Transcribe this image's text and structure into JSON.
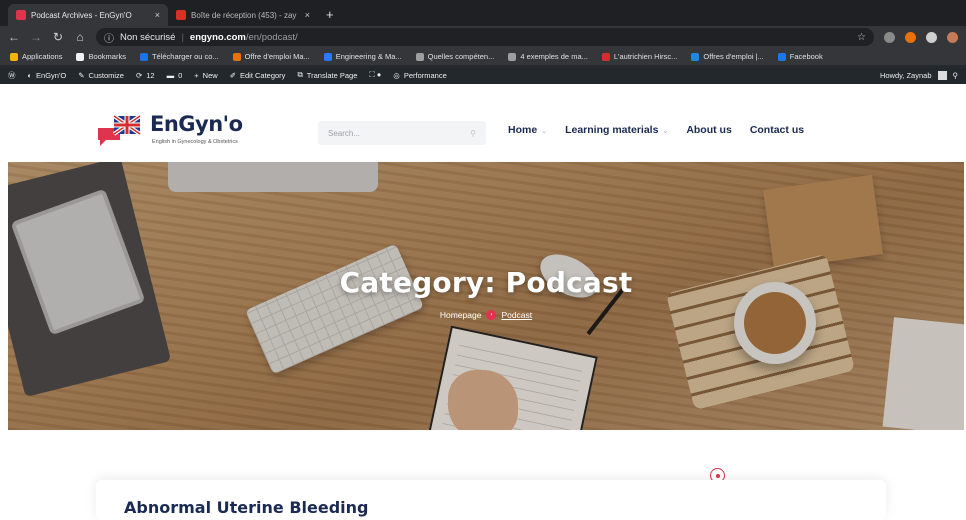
{
  "browser": {
    "tabs": [
      {
        "title": "Podcast Archives - EnGyn'O",
        "favicon_color": "#e0334e"
      },
      {
        "title": "Boîte de réception (453) - zay",
        "favicon_color": "#d93025"
      }
    ],
    "tab_close": "×",
    "new_tab": "+",
    "security_label": "Non sécurisé",
    "url_host": "engyno.com",
    "url_path": "/en/podcast/"
  },
  "bookmarks": [
    {
      "label": "Applications",
      "color": "#f4b400"
    },
    {
      "label": "Bookmarks",
      "color": "#f1f1f1"
    },
    {
      "label": "Télécharger ou co...",
      "color": "#1a73e8"
    },
    {
      "label": "Offre d'emploi Ma...",
      "color": "#e8710a"
    },
    {
      "label": "Engineering & Ma...",
      "color": "#2979ff"
    },
    {
      "label": "Quelles compéten...",
      "color": "#9e9e9e"
    },
    {
      "label": "4 exemples de ma...",
      "color": "#9e9e9e"
    },
    {
      "label": "L'autrichien Hirsc...",
      "color": "#d32f2f"
    },
    {
      "label": "Offres d'emploi |...",
      "color": "#1e88e5"
    },
    {
      "label": "Facebook",
      "color": "#1877f2"
    }
  ],
  "wp_admin": {
    "site": "EnGyn'O",
    "customize": "Customize",
    "updates_count": "12",
    "comments_count": "0",
    "new_label": "New",
    "edit_label": "Edit Category",
    "translate_label": "Translate Page",
    "performance_label": "Performance",
    "greeting": "Howdy, Zaynab"
  },
  "site": {
    "brand": "EnGyn'o",
    "tagline": "English in Gynecology & Obstetrics",
    "search_placeholder": "Search...",
    "nav": [
      {
        "label": "Home",
        "has_dropdown": true
      },
      {
        "label": "Learning materials",
        "has_dropdown": true
      },
      {
        "label": "About us",
        "has_dropdown": false
      },
      {
        "label": "Contact us",
        "has_dropdown": false
      }
    ]
  },
  "hero": {
    "title": "Category: Podcast",
    "breadcrumb": {
      "home": "Homepage",
      "current": "Podcast"
    }
  },
  "first_post": {
    "title": "Abnormal Uterine Bleeding"
  },
  "colors": {
    "accent": "#e0334e",
    "navy": "#1b2a52"
  }
}
